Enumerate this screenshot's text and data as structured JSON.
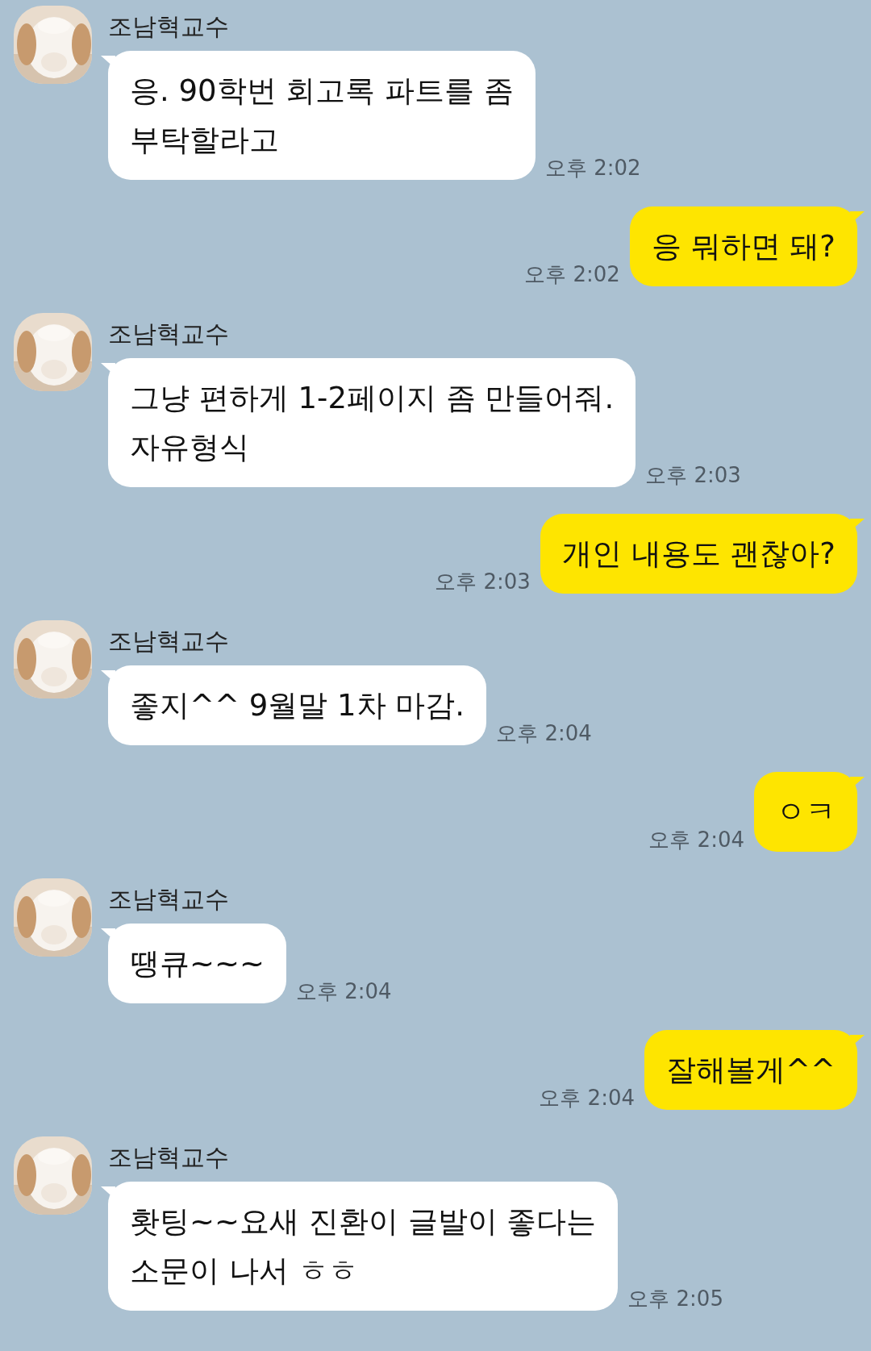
{
  "messages": [
    {
      "kind": "incoming",
      "sender": "조남혁교수",
      "text": "응. 90학번 회고록 파트를 좀\n부탁할라고",
      "time": "오후 2:02"
    },
    {
      "kind": "outgoing",
      "text": "응 뭐하면 돼?",
      "time": "오후 2:02"
    },
    {
      "kind": "incoming",
      "sender": "조남혁교수",
      "text": "그냥 편하게 1-2페이지 좀 만들어줘.\n자유형식",
      "time": "오후 2:03"
    },
    {
      "kind": "outgoing",
      "text": "개인 내용도 괜찮아?",
      "time": "오후 2:03"
    },
    {
      "kind": "incoming",
      "sender": "조남혁교수",
      "text": "좋지^^ 9월말 1차 마감.",
      "time": "오후 2:04"
    },
    {
      "kind": "outgoing",
      "text": "ㅇㅋ",
      "time": "오후 2:04"
    },
    {
      "kind": "incoming",
      "sender": "조남혁교수",
      "text": "땡큐~~~",
      "time": "오후 2:04"
    },
    {
      "kind": "outgoing",
      "text": "잘해볼게^^",
      "time": "오후 2:04"
    },
    {
      "kind": "incoming",
      "sender": "조남혁교수",
      "text": "홧팅~~요새 진환이 글발이 좋다는\n소문이 나서 ㅎㅎ",
      "time": "오후 2:05"
    }
  ]
}
